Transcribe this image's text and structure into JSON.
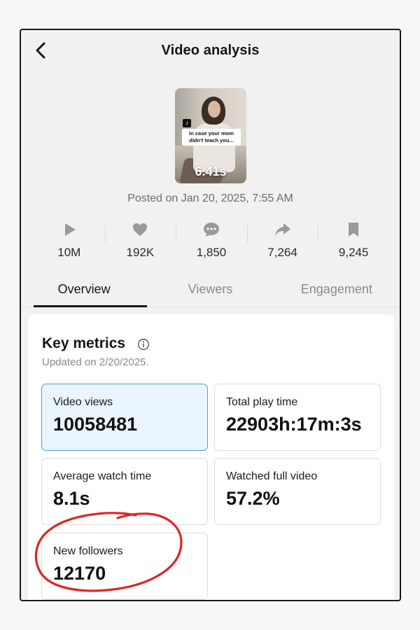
{
  "header": {
    "title": "Video analysis",
    "back_icon": "chevron-left-icon"
  },
  "video": {
    "duration": "6.41s",
    "caption": "In case your mom didn't teach you...",
    "posted": "Posted on Jan 20, 2025, 7:55 AM"
  },
  "stats": [
    {
      "icon": "play-icon",
      "value": "10M"
    },
    {
      "icon": "heart-icon",
      "value": "192K"
    },
    {
      "icon": "comment-icon",
      "value": "1,850"
    },
    {
      "icon": "share-icon",
      "value": "7,264"
    },
    {
      "icon": "bookmark-icon",
      "value": "9,245"
    }
  ],
  "tabs": [
    {
      "label": "Overview",
      "active": true
    },
    {
      "label": "Viewers",
      "active": false
    },
    {
      "label": "Engagement",
      "active": false
    }
  ],
  "key_metrics": {
    "title": "Key metrics",
    "updated": "Updated on 2/20/2025.",
    "items": [
      {
        "label": "Video views",
        "value": "10058481",
        "selected": true
      },
      {
        "label": "Total play time",
        "value": "22903h:17m:3s",
        "selected": false
      },
      {
        "label": "Average watch time",
        "value": "8.1s",
        "selected": false
      },
      {
        "label": "Watched full video",
        "value": "57.2%",
        "selected": false
      },
      {
        "label": "New followers",
        "value": "12170",
        "selected": false
      }
    ]
  },
  "colors": {
    "selected_card_bg": "#eaf4fd",
    "selected_card_border": "#4d9be0",
    "annotation_red": "#e02424"
  }
}
